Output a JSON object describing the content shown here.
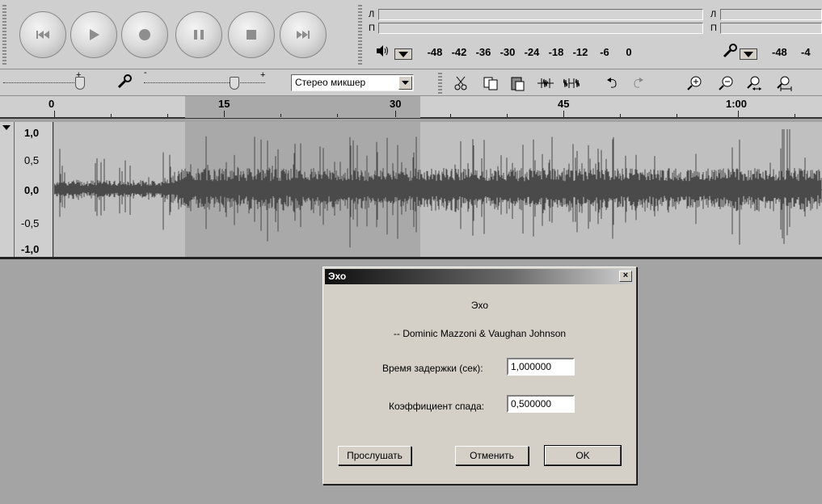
{
  "transport": {
    "buttons": [
      {
        "name": "skip-to-start-icon"
      },
      {
        "name": "play-icon"
      },
      {
        "name": "record-icon"
      },
      {
        "name": "pause-icon"
      },
      {
        "name": "stop-icon"
      },
      {
        "name": "skip-to-end-icon"
      }
    ]
  },
  "meters": {
    "left_channel": "Л",
    "right_channel": "П",
    "scale": [
      "-48",
      "-42",
      "-36",
      "-30",
      "-24",
      "-18",
      "-12",
      "-6",
      "0"
    ],
    "scale_cut": "-48",
    "scale_cut2": "-4"
  },
  "mixer": {
    "input_source": "Стерео микшер",
    "output_minus": "-",
    "output_plus": "+",
    "input_minus": "-",
    "input_plus": "+"
  },
  "ruler": {
    "labels": [
      "0",
      "15",
      "30",
      "45",
      "1:00"
    ]
  },
  "track": {
    "scale_labels": [
      "1,0",
      "0,5",
      "0,0",
      "-0,5",
      "-1,0"
    ]
  },
  "dialog": {
    "window_title": "Эхо",
    "heading": "Эхо",
    "authors": "-- Dominic Mazzoni & Vaughan Johnson",
    "delay_label": "Время задержки (сек):",
    "delay_value": "1,000000",
    "decay_label": "Коэффициент спада:",
    "decay_value": "0,500000",
    "preview_button": "Прослушать",
    "cancel_button": "Отменить",
    "ok_button": "OK",
    "close_glyph": "×"
  }
}
